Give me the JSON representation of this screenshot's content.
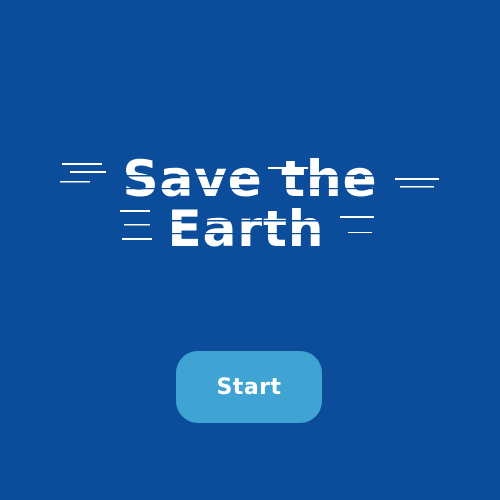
{
  "title": {
    "line1": "Save the",
    "line2": "Earth"
  },
  "start_button": {
    "label": "Start"
  },
  "colors": {
    "background": "#0b4d9b",
    "button": "#3fa4d4",
    "text": "#ffffff"
  }
}
